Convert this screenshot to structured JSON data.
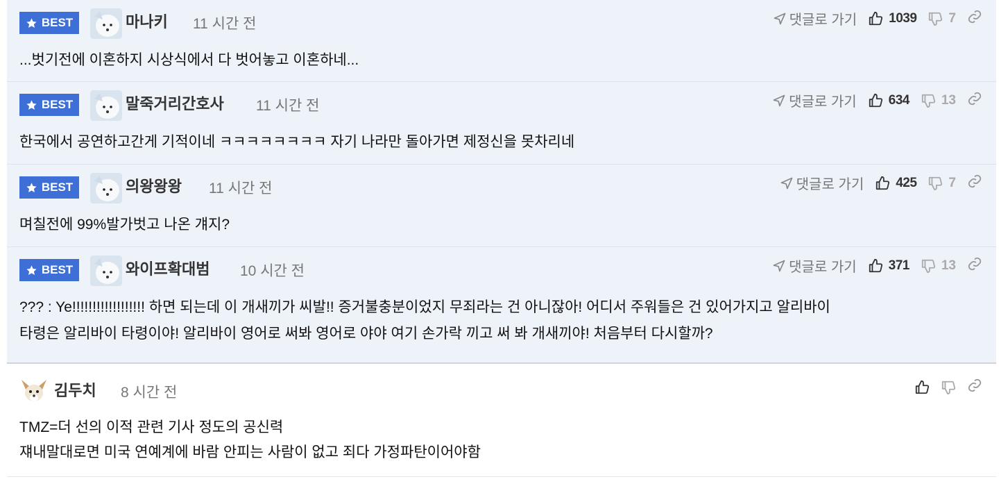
{
  "best_label": "BEST",
  "goto_label": "댓글로 가기",
  "best_comments": [
    {
      "author": "마나키",
      "time": "11 시간 전",
      "text": "...벗기전에 이혼하지 시상식에서 다 벗어놓고 이혼하네...",
      "up": "1039",
      "down": "7"
    },
    {
      "author": "말죽거리간호사",
      "time": "11 시간 전",
      "text": "한국에서 공연하고간게 기적이네 ㅋㅋㅋㅋㅋㅋㅋㅋ 자기 나라만 돌아가면 제정신을 못차리네",
      "up": "634",
      "down": "13"
    },
    {
      "author": "의왕왕왕",
      "time": "11 시간 전",
      "text": "며칠전에 99%발가벗고 나온 걔지?",
      "up": "425",
      "down": "7"
    },
    {
      "author": "와이프확대범",
      "time": "10 시간 전",
      "text_lines": [
        "??? : Ye!!!!!!!!!!!!!!!!!! 하면 되는데 이 개새끼가 씨발!! 증거불충분이었지 무죄라는 건 아니잖아! 어디서 주워들은 건 있어가지고 알리바이",
        "타령은 알리바이 타령이야! 알리바이 영어로 써봐 영어로 야야 여기 손가락 끼고 써 봐 개새끼야! 처음부터 다시할까?"
      ],
      "up": "371",
      "down": "13"
    }
  ],
  "comments": [
    {
      "author": "김두치",
      "time": "8 시간 전",
      "text_lines": [
        "TMZ=더 선의 이적 관련 기사 정도의 공신력",
        "쟤내말대로면 미국 연예계에 바람 안피는 사람이 없고 죄다 가정파탄이어야함"
      ]
    }
  ],
  "colors": {
    "badge": "#3d6fd6",
    "best_bg": "#eef2f9"
  }
}
